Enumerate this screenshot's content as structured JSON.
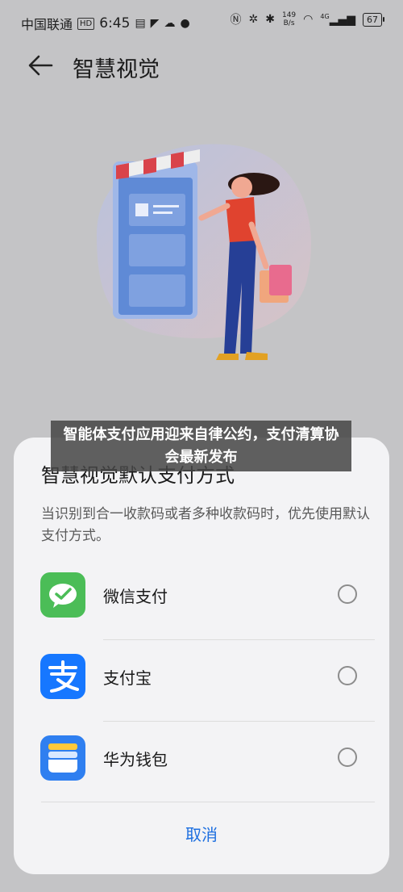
{
  "status_bar": {
    "carrier": "中国联通",
    "hd_badge": "HD",
    "time": "6:45",
    "network_speed_value": "149",
    "network_speed_unit": "B/s",
    "signal_label": "4G",
    "battery": "67"
  },
  "header": {
    "title": "智慧视觉"
  },
  "sheet": {
    "title": "智慧视觉默认支付方式",
    "description": "当识别到合一收款码或者多种收款码时，优先使用默认支付方式。",
    "options": [
      {
        "label": "微信支付",
        "icon": "wechat-pay-icon",
        "color": "#4bbd57",
        "selected": false
      },
      {
        "label": "支付宝",
        "icon": "alipay-icon",
        "color": "#1677ff",
        "selected": false
      },
      {
        "label": "华为钱包",
        "icon": "huawei-wallet-icon",
        "color": "#2f7ff0",
        "selected": false
      }
    ],
    "cancel_label": "取消"
  },
  "banner": {
    "text": "智能体支付应用迎来自律公约，支付清算协会最新发布"
  },
  "colors": {
    "accent": "#1d6fe0",
    "background": "#c4c4c6",
    "sheet": "#f3f3f5"
  }
}
